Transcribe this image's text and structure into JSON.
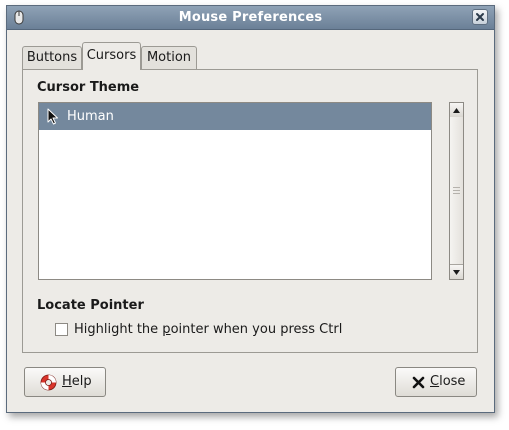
{
  "window": {
    "title": "Mouse Preferences"
  },
  "tabs": [
    {
      "label": "Buttons",
      "active": false
    },
    {
      "label": "Cursors",
      "active": true
    },
    {
      "label": "Motion",
      "active": false
    }
  ],
  "cursor_theme": {
    "heading": "Cursor Theme",
    "items": [
      {
        "label": "Human",
        "selected": true
      }
    ]
  },
  "locate_pointer": {
    "heading": "Locate Pointer",
    "checkbox_label_pre": "Highlight the ",
    "checkbox_label_mnemonic": "p",
    "checkbox_label_post": "ointer when you press Ctrl",
    "checked": false
  },
  "buttons": {
    "help_mnemonic": "H",
    "help_rest": "elp",
    "close_mnemonic": "C",
    "close_rest": "lose"
  },
  "colors": {
    "titlebar": "#6b8097",
    "selection": "#74889d",
    "window_bg": "#edebe7"
  },
  "icons": {
    "window": "mouse-icon",
    "close": "close-icon",
    "cursor": "arrow-cursor-icon",
    "help": "lifebuoy-icon",
    "close_button": "x-icon"
  }
}
